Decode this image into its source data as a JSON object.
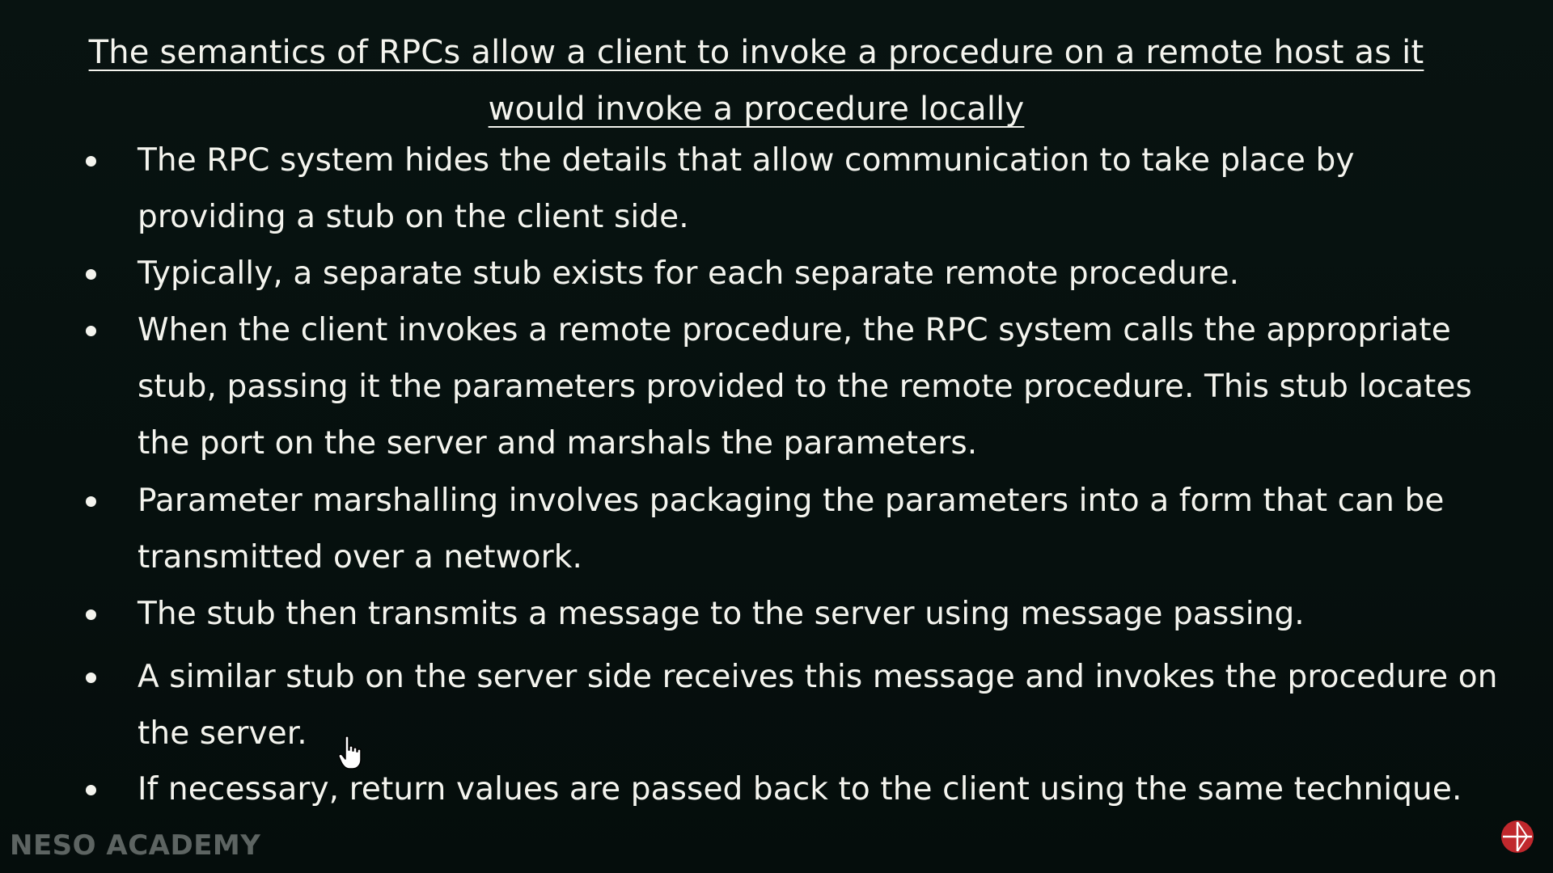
{
  "slide": {
    "heading": "The semantics of RPCs allow a client to invoke a procedure on a remote host as it would invoke a procedure locally",
    "bullets": [
      "The RPC system hides the details that allow communication to take place by providing a stub on the client side.",
      "Typically, a separate stub exists for each separate remote procedure.",
      "When the client invokes a remote procedure, the RPC system calls the appropriate stub, passing it the parameters provided to the remote procedure. This stub locates the port on the server and marshals the parameters.",
      "Parameter marshalling involves packaging the parameters into a form that can be transmitted over a network.",
      "The stub then transmits a message to the server using message passing.",
      "A similar stub on the server side receives this message and invokes the procedure on the server.",
      "If necessary, return values are passed back to the client using the same technique."
    ]
  },
  "branding": {
    "watermark": "NESO ACADEMY"
  },
  "icons": {
    "cursor": "hand-pointer-icon",
    "corner_logo": "neso-logo-icon"
  },
  "colors": {
    "background": "#07110f",
    "text": "#f4f4ee",
    "watermark": "#5d6462",
    "logo_red": "#c0282d"
  }
}
